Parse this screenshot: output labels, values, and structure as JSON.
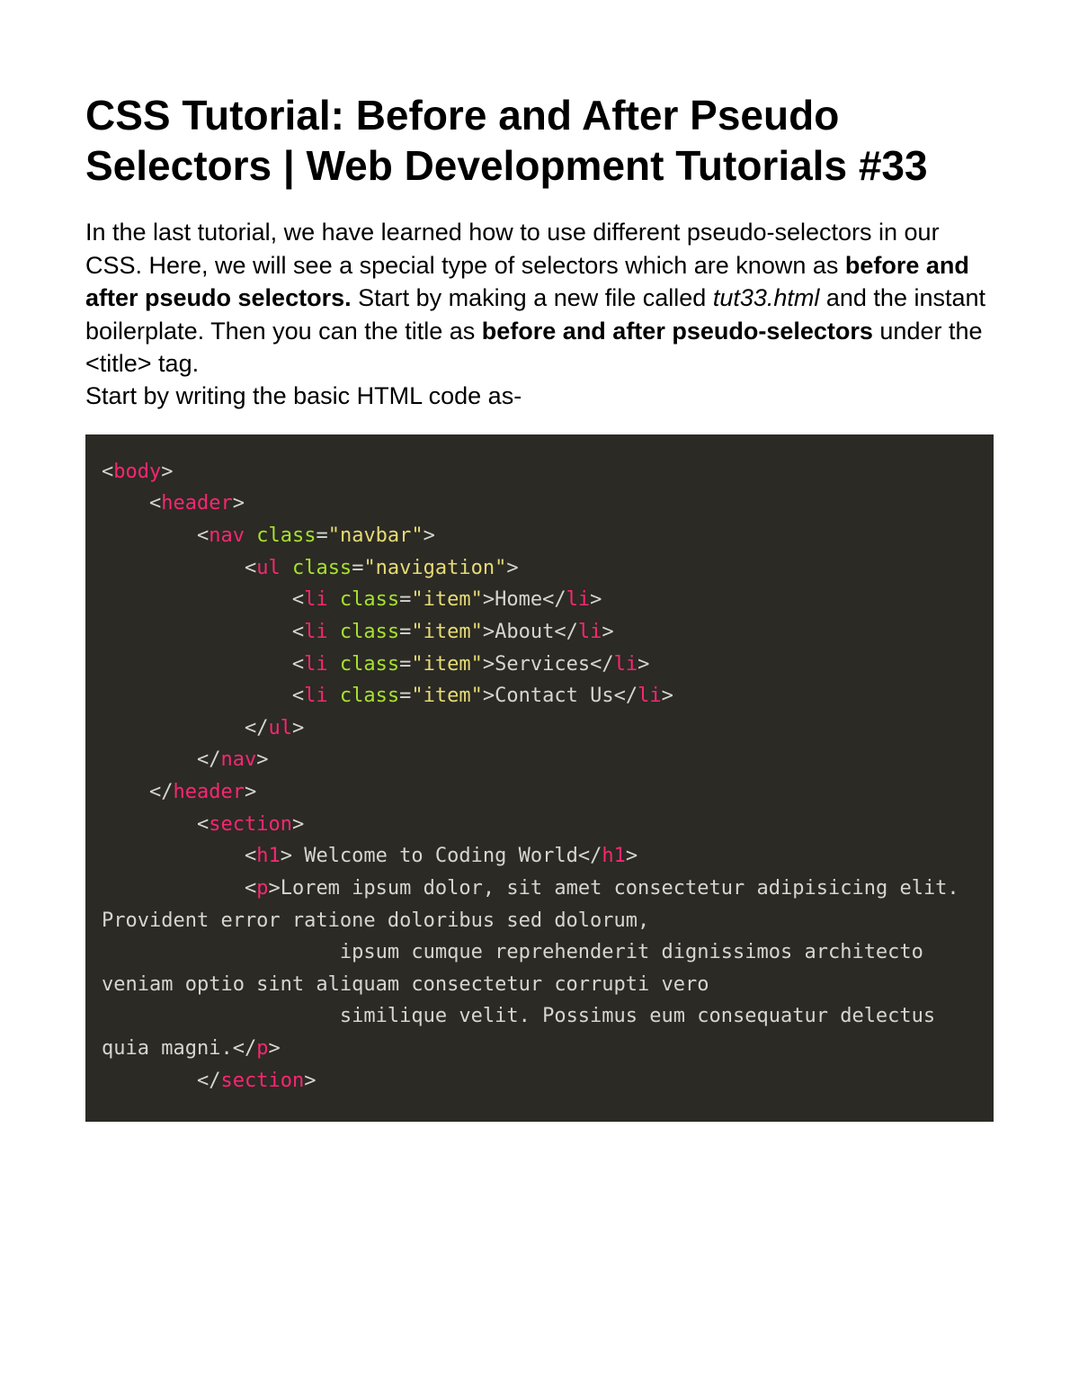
{
  "title": "CSS Tutorial: Before and After Pseudo Selectors | Web Development Tutorials #33",
  "intro": {
    "p1a": "In the last tutorial, we have learned how to use different pseudo-selectors in our CSS. Here, we will see a special type of selectors which are known as ",
    "p1b": "before and after pseudo selectors.",
    "p1c": " Start by making a new file called ",
    "p1d": "tut33.html",
    "p1e": " and the instant boilerplate. Then you can the title as ",
    "p1f": "before and after pseudo-selectors",
    "p1g": " under the <title> tag.",
    "p2": "Start by writing the basic HTML code as-"
  },
  "code": {
    "tags": {
      "body": "body",
      "header": "header",
      "nav": "nav",
      "ul": "ul",
      "li": "li",
      "section": "section",
      "h1": "h1",
      "p": "p"
    },
    "attrs": {
      "class": "class"
    },
    "values": {
      "navbar": "\"navbar\"",
      "navigation": "\"navigation\"",
      "item": "\"item\""
    },
    "content": {
      "home": "Home",
      "about": "About",
      "services": "Services",
      "contact": "Contact Us",
      "h1text": " Welcome to Coding World",
      "para1": "Lorem ipsum dolor, sit amet consectetur adipisicing elit. Provident error ratione doloribus sed dolorum,",
      "para2": "                    ipsum cumque reprehenderit dignissimos architecto veniam optio sint aliquam consectetur corrupti vero",
      "para3": "                    similique velit. Possimus eum consequatur delectus quia magni."
    },
    "punct": {
      "lt": "<",
      "gt": ">",
      "ltsl": "</",
      "eq": "=",
      "sp": " "
    }
  }
}
